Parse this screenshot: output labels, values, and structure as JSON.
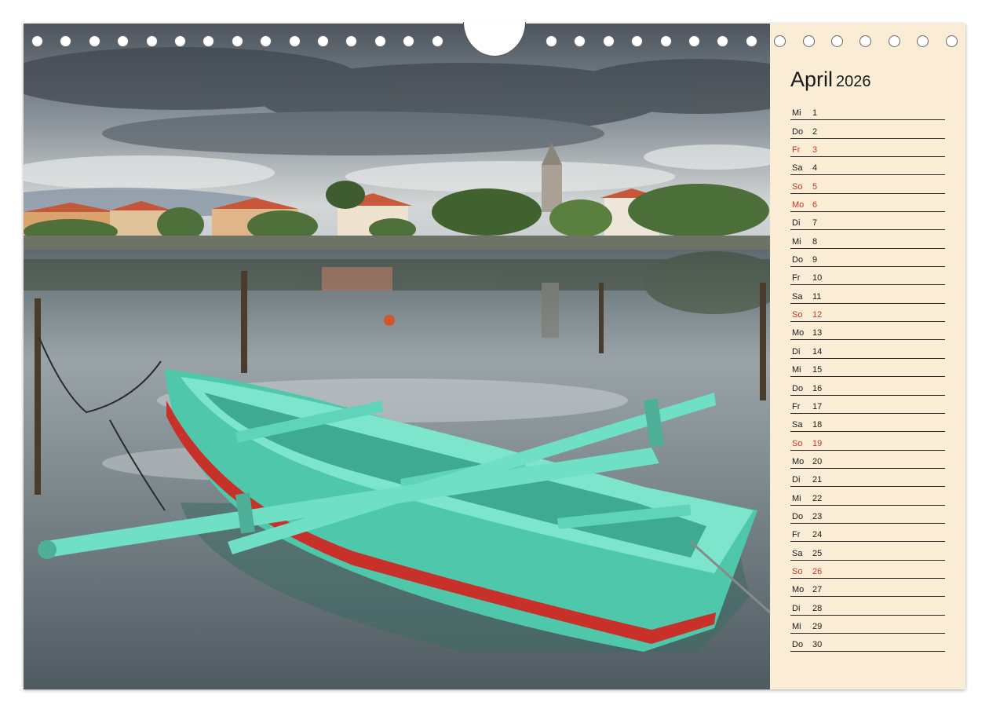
{
  "calendar": {
    "month": "April",
    "year": "2026",
    "days": [
      {
        "abbr": "Mi",
        "num": "1",
        "holiday": false
      },
      {
        "abbr": "Do",
        "num": "2",
        "holiday": false
      },
      {
        "abbr": "Fr",
        "num": "3",
        "holiday": true
      },
      {
        "abbr": "Sa",
        "num": "4",
        "holiday": false
      },
      {
        "abbr": "So",
        "num": "5",
        "holiday": true
      },
      {
        "abbr": "Mo",
        "num": "6",
        "holiday": true
      },
      {
        "abbr": "Di",
        "num": "7",
        "holiday": false
      },
      {
        "abbr": "Mi",
        "num": "8",
        "holiday": false
      },
      {
        "abbr": "Do",
        "num": "9",
        "holiday": false
      },
      {
        "abbr": "Fr",
        "num": "10",
        "holiday": false
      },
      {
        "abbr": "Sa",
        "num": "11",
        "holiday": false
      },
      {
        "abbr": "So",
        "num": "12",
        "holiday": true
      },
      {
        "abbr": "Mo",
        "num": "13",
        "holiday": false
      },
      {
        "abbr": "Di",
        "num": "14",
        "holiday": false
      },
      {
        "abbr": "Mi",
        "num": "15",
        "holiday": false
      },
      {
        "abbr": "Do",
        "num": "16",
        "holiday": false
      },
      {
        "abbr": "Fr",
        "num": "17",
        "holiday": false
      },
      {
        "abbr": "Sa",
        "num": "18",
        "holiday": false
      },
      {
        "abbr": "So",
        "num": "19",
        "holiday": true
      },
      {
        "abbr": "Mo",
        "num": "20",
        "holiday": false
      },
      {
        "abbr": "Di",
        "num": "21",
        "holiday": false
      },
      {
        "abbr": "Mi",
        "num": "22",
        "holiday": false
      },
      {
        "abbr": "Do",
        "num": "23",
        "holiday": false
      },
      {
        "abbr": "Fr",
        "num": "24",
        "holiday": false
      },
      {
        "abbr": "Sa",
        "num": "25",
        "holiday": false
      },
      {
        "abbr": "So",
        "num": "26",
        "holiday": true
      },
      {
        "abbr": "Mo",
        "num": "27",
        "holiday": false
      },
      {
        "abbr": "Di",
        "num": "28",
        "holiday": false
      },
      {
        "abbr": "Mi",
        "num": "29",
        "holiday": false
      },
      {
        "abbr": "Do",
        "num": "30",
        "holiday": false
      }
    ]
  },
  "colors": {
    "sidebar_bg": "#fbecd6",
    "holiday_text": "#c0392b",
    "boat_turquoise": "#5fd4b8",
    "boat_stripe": "#c8302a"
  },
  "photo": {
    "icons": [
      "rowing-boat",
      "church-tower",
      "buoy"
    ]
  }
}
